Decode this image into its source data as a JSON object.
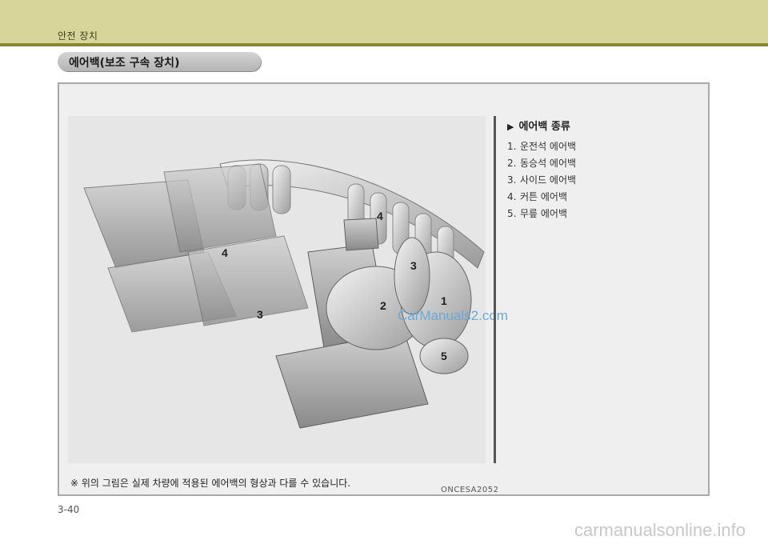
{
  "header": {
    "chapter": "안전 장치"
  },
  "section": {
    "title": "에어백(보조 구속 장치)"
  },
  "figure": {
    "code": "ONCESA2052",
    "watermark": "CarManuals2.com",
    "callouts": [
      "4",
      "4",
      "3",
      "3",
      "2",
      "1",
      "5"
    ]
  },
  "legend": {
    "title": "에어백 종류",
    "items": [
      {
        "num": "1.",
        "label": "운전석 에어백"
      },
      {
        "num": "2.",
        "label": "동승석 에어백"
      },
      {
        "num": "3.",
        "label": "사이드 에어백"
      },
      {
        "num": "4.",
        "label": "커튼 에어백"
      },
      {
        "num": "5.",
        "label": "무릎 에어백"
      }
    ]
  },
  "note": "※ 위의 그림은 실제 차량에 적용된 에어백의 형상과 다를 수 있습니다.",
  "footer": {
    "page": "3-40",
    "site": "carmanualsonline.info"
  },
  "colors": {
    "band": "#d8d59a",
    "rule": "#8b8431",
    "panel": "#efefef"
  }
}
